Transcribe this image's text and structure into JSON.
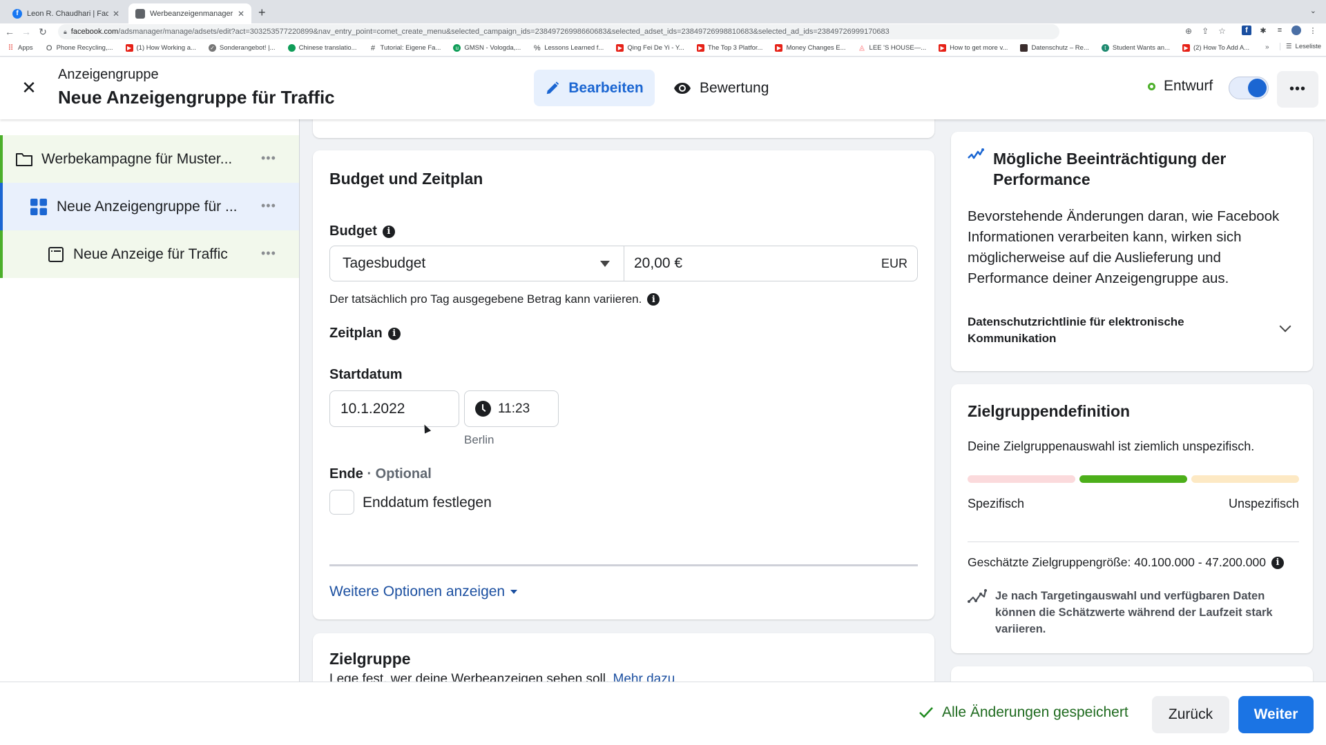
{
  "browser": {
    "tabs": [
      {
        "label": "Leon R. Chaudhari | Facebook",
        "icon": "facebook-icon",
        "active": false
      },
      {
        "label": "Werbeanzeigenmanager - Wer",
        "icon": "adsmanager-icon",
        "active": true
      }
    ],
    "new_tab_label": "+",
    "url_host": "facebook.com",
    "url_path": "/adsmanager/manage/adsets/edit?act=303253577220899&nav_entry_point=comet_create_menu&selected_campaign_ids=23849726998660683&selected_adset_ids=23849726998810683&selected_ad_ids=23849726999170683",
    "bookmarks": [
      {
        "label": "Apps",
        "icon": "apps-grid-icon"
      },
      {
        "label": "Phone Recycling,...",
        "icon": "o2-icon"
      },
      {
        "label": "(1) How Working a...",
        "icon": "youtube-icon"
      },
      {
        "label": "Sonderangebot! |...",
        "icon": "check-badge-icon"
      },
      {
        "label": "Chinese translatio...",
        "icon": "green-circle-icon"
      },
      {
        "label": "Tutorial: Eigene Fa...",
        "icon": "hash-icon"
      },
      {
        "label": "GMSN - Vologda,...",
        "icon": "upwork-icon"
      },
      {
        "label": "Lessons Learned f...",
        "icon": "percent-icon"
      },
      {
        "label": "Qing Fei De Yi - Y...",
        "icon": "youtube-icon"
      },
      {
        "label": "The Top 3 Platfor...",
        "icon": "youtube-icon"
      },
      {
        "label": "Money Changes E...",
        "icon": "youtube-icon"
      },
      {
        "label": "LEE 'S HOUSE—...",
        "icon": "airbnb-icon"
      },
      {
        "label": "How to get more v...",
        "icon": "youtube-icon"
      },
      {
        "label": "Datenschutz – Re...",
        "icon": "photo-icon"
      },
      {
        "label": "Student Wants an...",
        "icon": "teal-t-icon"
      },
      {
        "label": "(2) How To Add A...",
        "icon": "youtube-icon"
      }
    ],
    "bookmarks_overflow": "»",
    "reading_list": "Leseliste"
  },
  "header": {
    "subtitle": "Anzeigengruppe",
    "title": "Neue Anzeigengruppe für Traffic",
    "edit_label": "Bearbeiten",
    "review_label": "Bewertung",
    "status_label": "Entwurf",
    "status_color": "#4caf2a",
    "toggle_on": true,
    "more_label": "•••"
  },
  "sidebar": {
    "items": [
      {
        "label": "Werbekampagne für Muster...",
        "icon": "folder-icon",
        "level": 0,
        "selected": false
      },
      {
        "label": "Neue Anzeigengruppe für ...",
        "icon": "adset-grid-icon",
        "level": 1,
        "selected": true
      },
      {
        "label": "Neue Anzeige für Traffic",
        "icon": "ad-window-icon",
        "level": 2,
        "selected": false
      }
    ],
    "more_label": "•••"
  },
  "budget_section": {
    "title": "Budget und Zeitplan",
    "budget_label": "Budget",
    "budget_type": "Tagesbudget",
    "budget_amount": "20,00 €",
    "currency": "EUR",
    "budget_hint": "Der tatsächlich pro Tag ausgegebene Betrag kann variieren.",
    "schedule_label": "Zeitplan",
    "start_label": "Startdatum",
    "start_date": "10.1.2022",
    "start_time": "11:23",
    "timezone": "Berlin",
    "end_label": "Ende",
    "end_optional": "· Optional",
    "end_checkbox_label": "Enddatum festlegen",
    "end_checked": false,
    "more_options": "Weitere Optionen anzeigen"
  },
  "audience_section": {
    "title": "Zielgruppe",
    "description": "Lege fest, wer deine Werbeanzeigen sehen soll.",
    "link": "Mehr dazu"
  },
  "performance_card": {
    "title": "Mögliche Beeinträchtigung der Performance",
    "body": "Bevorstehende Änderungen daran, wie Facebook Informationen verarbeiten kann, wirken sich möglicherweise auf die Auslieferung und Performance deiner Anzeigengruppe aus.",
    "policy_label": "Datenschutzrichtlinie für elektronische Kommunikation"
  },
  "definition_card": {
    "title": "Zielgruppendefinition",
    "description": "Deine Zielgruppenauswahl ist ziemlich unspezifisch.",
    "meter_segments": [
      {
        "color": "#fbdadc",
        "active": false
      },
      {
        "color": "#4caf1a",
        "active": true
      },
      {
        "color": "#fde9c4",
        "active": false
      }
    ],
    "meter_active_segment": 2,
    "meter_segment_count": 3,
    "label_left": "Spezifisch",
    "label_right": "Unspezifisch",
    "size_text": "Geschätzte Zielgruppengröße: 40.100.000 - 47.200.000",
    "note": "Je nach Targetingauswahl und verfügbaren Daten können die Schätzwerte während der Laufzeit stark variieren."
  },
  "footer": {
    "saved_text": "Alle Änderungen gespeichert",
    "back_label": "Zurück",
    "next_label": "Weiter"
  },
  "colors": {
    "primary": "#1b74e4",
    "link": "#1b4fa0",
    "success": "#1e6a1e"
  }
}
